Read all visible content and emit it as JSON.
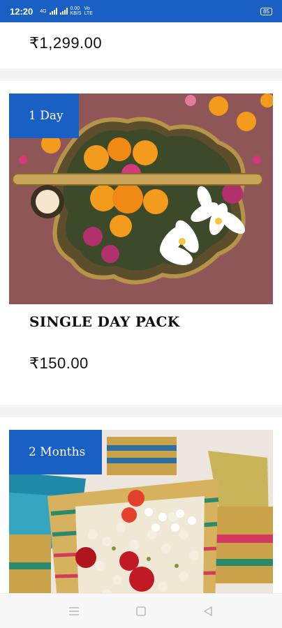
{
  "status_bar": {
    "time": "12:20",
    "network_label": "4G",
    "speed_value": "0.00",
    "speed_unit": "KB/S",
    "volte": "Vo LTE",
    "battery": "85"
  },
  "previous_card": {
    "price": "₹1,299.00"
  },
  "packs": [
    {
      "badge": "1 Day",
      "title": "SINGLE DAY PACK",
      "price": "₹150.00"
    },
    {
      "badge": "2 Months"
    }
  ],
  "nav": {
    "menu_icon": "menu-icon",
    "home_icon": "home-square-icon",
    "back_icon": "back-triangle-icon"
  },
  "colors": {
    "accent": "#1a5fc4"
  }
}
